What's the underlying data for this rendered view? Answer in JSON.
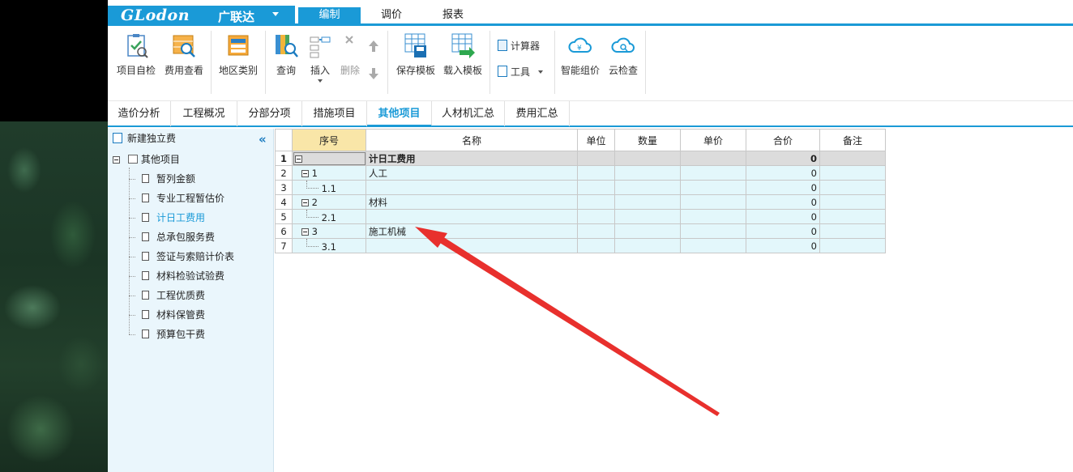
{
  "brand": {
    "logo_text": "GLodon",
    "logo_cn": "广联达"
  },
  "menu_tabs": [
    {
      "label": "编制",
      "active": true
    },
    {
      "label": "调价"
    },
    {
      "label": "报表"
    }
  ],
  "ribbon": {
    "buttons": [
      {
        "label": "项目自检",
        "icon": "check-clipboard-icon"
      },
      {
        "label": "费用查看",
        "icon": "cost-view-icon"
      },
      {
        "label": "地区类别",
        "icon": "region-category-icon"
      },
      {
        "label": "查询",
        "icon": "search-book-icon"
      },
      {
        "label": "插入",
        "icon": "insert-icon"
      },
      {
        "label": "删除",
        "icon": "delete-icon",
        "disabled": true
      },
      {
        "label": "保存模板",
        "icon": "save-template-icon"
      },
      {
        "label": "载入模板",
        "icon": "load-template-icon"
      },
      {
        "label": "计算器",
        "icon": "calculator-icon"
      },
      {
        "label": "工具",
        "icon": "tools-icon"
      },
      {
        "label": "智能组价",
        "icon": "cloud-price-icon"
      },
      {
        "label": "云检查",
        "icon": "cloud-check-icon"
      }
    ]
  },
  "doc_tabs": [
    {
      "label": "造价分析"
    },
    {
      "label": "工程概况"
    },
    {
      "label": "分部分项"
    },
    {
      "label": "措施项目"
    },
    {
      "label": "其他项目",
      "active": true
    },
    {
      "label": "人材机汇总"
    },
    {
      "label": "费用汇总"
    }
  ],
  "tree": {
    "new_item": "新建独立费",
    "root": "其他项目",
    "children": [
      "暂列金额",
      "专业工程暂估价",
      "计日工费用",
      "总承包服务费",
      "签证与索赔计价表",
      "材料检验试验费",
      "工程优质费",
      "材料保管费",
      "预算包干费"
    ],
    "selected": "计日工费用"
  },
  "grid": {
    "columns": [
      "",
      "序号",
      "名称",
      "单位",
      "数量",
      "单价",
      "合价",
      "备注"
    ],
    "rows": [
      {
        "n": "1",
        "seq": "",
        "name": "计日工费用",
        "unit": "",
        "qty": "",
        "price": "",
        "total": "0",
        "note": "",
        "level": 0
      },
      {
        "n": "2",
        "seq": "1",
        "name": "人工",
        "unit": "",
        "qty": "",
        "price": "",
        "total": "0",
        "note": "",
        "level": 1
      },
      {
        "n": "3",
        "seq": "1.1",
        "name": "",
        "unit": "",
        "qty": "",
        "price": "",
        "total": "0",
        "note": "",
        "level": 2
      },
      {
        "n": "4",
        "seq": "2",
        "name": "材料",
        "unit": "",
        "qty": "",
        "price": "",
        "total": "0",
        "note": "",
        "level": 1
      },
      {
        "n": "5",
        "seq": "2.1",
        "name": "",
        "unit": "",
        "qty": "",
        "price": "",
        "total": "0",
        "note": "",
        "level": 2
      },
      {
        "n": "6",
        "seq": "3",
        "name": "施工机械",
        "unit": "",
        "qty": "",
        "price": "",
        "total": "0",
        "note": "",
        "level": 1
      },
      {
        "n": "7",
        "seq": "3.1",
        "name": "",
        "unit": "",
        "qty": "",
        "price": "",
        "total": "0",
        "note": "",
        "level": 2
      }
    ]
  },
  "colors": {
    "accent": "#1a9ad7",
    "annotation_arrow": "#e8302d",
    "row_bg": "#e3f7fb",
    "header_highlight": "#f9e6a8"
  }
}
